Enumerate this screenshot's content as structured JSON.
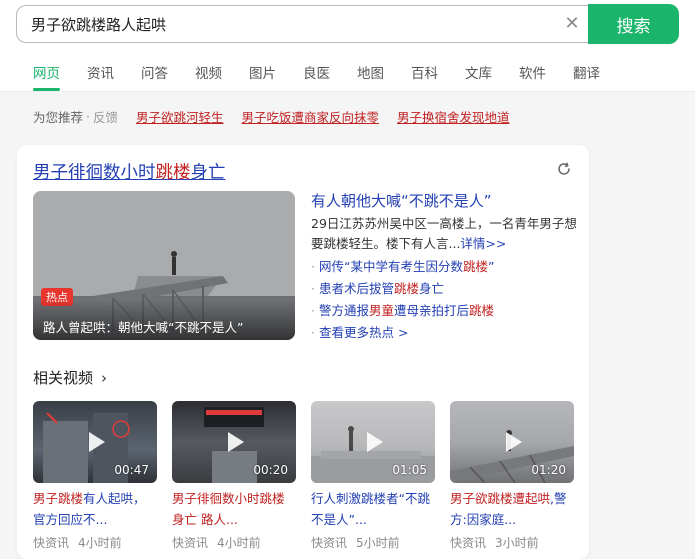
{
  "search": {
    "query": "男子欲跳楼路人起哄",
    "button_label": "搜索",
    "clear_icon": "close-icon"
  },
  "tabs": [
    {
      "label": "网页",
      "active": true
    },
    {
      "label": "资讯"
    },
    {
      "label": "问答"
    },
    {
      "label": "视频"
    },
    {
      "label": "图片"
    },
    {
      "label": "良医"
    },
    {
      "label": "地图"
    },
    {
      "label": "百科"
    },
    {
      "label": "文库"
    },
    {
      "label": "软件"
    },
    {
      "label": "翻译"
    }
  ],
  "recommend": {
    "label": "为您推荐",
    "separator": "·",
    "feedback": "反馈",
    "links": [
      "男子欲跳河轻生",
      "男子吃饭遭商家反向抹零",
      "男子换宿舍发现地道"
    ]
  },
  "card": {
    "title_pre": "男子徘徊数小时",
    "title_hl": "跳楼",
    "title_post": "身亡",
    "refresh_icon": "refresh-icon",
    "hero": {
      "badge": "热点",
      "caption": "路人曾起哄：朝他大喊“不跳不是人”"
    },
    "news": {
      "title": "有人朝他大喊“不跳不是人”",
      "desc": "29日江苏苏州吴中区一高楼上，一名青年男子想要跳楼轻生。楼下有人言...",
      "more": "详情>>",
      "bullets": [
        {
          "pre": "网传“某中学有考生因分数",
          "hl": "跳楼",
          "post": "”"
        },
        {
          "pre": "患者术后拔管",
          "hl": "跳楼",
          "post": "身亡"
        },
        {
          "pre": "警方通报",
          "hl": "男童",
          "post": "遭母亲拍打后",
          "hl2": "跳楼"
        },
        {
          "pre": "查看更多热点 >",
          "hl": "",
          "post": ""
        }
      ]
    },
    "related": {
      "heading": "相关视频",
      "chevron": "chevron-right-icon",
      "videos": [
        {
          "duration": "00:47",
          "title_a": "男子跳楼",
          "title_b": "有人起哄，官方回应不...",
          "source": "快资讯",
          "time": "4小时前"
        },
        {
          "duration": "00:20",
          "title_a": "男子徘徊数小时跳楼",
          "title_b": "身亡 路人...",
          "source": "快资讯",
          "time": "4小时前"
        },
        {
          "duration": "01:05",
          "title_a": "行人刺激跳楼",
          "title_b": "者“不跳不是人”...",
          "source": "快资讯",
          "time": "5小时前"
        },
        {
          "duration": "01:20",
          "title_a": "男子欲跳楼遭起哄",
          "title_b": ",警方:因家庭...",
          "source": "快资讯",
          "time": "3小时前"
        }
      ]
    }
  }
}
